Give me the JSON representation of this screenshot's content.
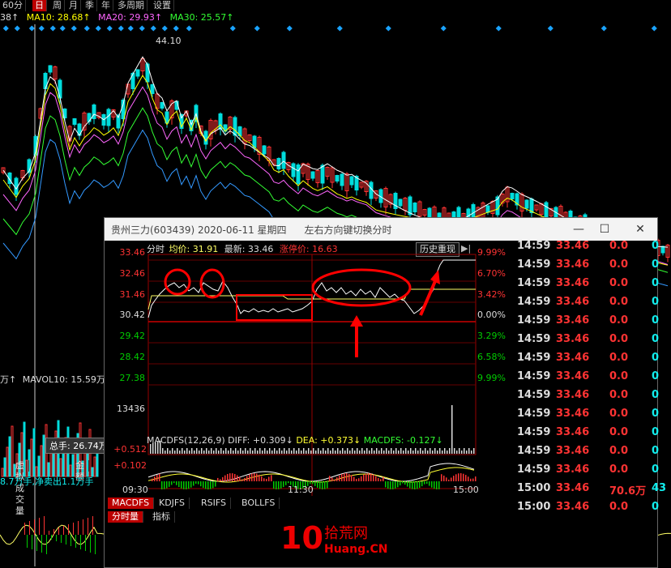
{
  "main_chart": {
    "tabs": [
      {
        "label": "60分",
        "active": false
      },
      {
        "label": "日",
        "active": true
      },
      {
        "label": "周",
        "active": false
      },
      {
        "label": "月",
        "active": false
      },
      {
        "label": "季",
        "active": false
      },
      {
        "label": "年",
        "active": false
      },
      {
        "label": "多周期",
        "active": false
      },
      {
        "label": "设置",
        "active": false
      }
    ],
    "ma_line": {
      "ma5_tail": "38↑",
      "ma10": "MA10: 28.68↑",
      "ma20": "MA20: 29.93↑",
      "ma30": "MA30: 25.57↑"
    },
    "high_label": "44.10",
    "volume_panel": {
      "mavol_left": "万↑",
      "mavol10": "MAVOL10: 15.59万↑",
      "tooltip": "总手: 26.74万"
    },
    "bottom_tabs": [
      "虚拟成交量",
      "金额"
    ],
    "bottom_info": "8.7万手,净卖出1.1万手"
  },
  "popup": {
    "title": "贵州三力(603439)  2020-06-11 星期四",
    "hint": "左右方向键切换分时",
    "info": {
      "label": "分时",
      "avg": "均价: 31.91",
      "latest": "最新: 33.46",
      "limit": "涨停价: 16.63"
    },
    "history_button": "历史重现",
    "left_ticks": [
      "33.46",
      "32.46",
      "31.46",
      "30.42",
      "29.42",
      "28.42",
      "27.38"
    ],
    "right_ticks": [
      "9.99%",
      "6.70%",
      "3.42%",
      "0.00%",
      "3.29%",
      "6.58%",
      "9.99%"
    ],
    "volume_tick": "13436",
    "macd_line": {
      "title": "MACDFS(12,26,9)",
      "diff": "DIFF: +0.309↓",
      "dea": "DEA: +0.373↓",
      "macdfs": "MACDFS: -0.127↓"
    },
    "macd_ticks": [
      "+0.512",
      "+0.102"
    ],
    "time_labels": [
      "09:30",
      "11:30",
      "15:00"
    ],
    "indicator_tabs": [
      {
        "label": "MACDFS",
        "active": true
      },
      {
        "label": "KDJFS",
        "active": false
      },
      {
        "label": "RSIFS",
        "active": false
      },
      {
        "label": "BOLLFS",
        "active": false
      }
    ],
    "sub_tabs": [
      {
        "label": "分时量",
        "active": true
      },
      {
        "label": "指标",
        "active": false
      }
    ],
    "colors": {
      "up": "#ff3333",
      "down": "#00cc00",
      "axis": "#b00000",
      "price_line": "#ffffff",
      "avg_line": "#ffff66"
    }
  },
  "tick_table": [
    {
      "time": "14:59",
      "price": "33.46",
      "vol": "0.0",
      "cnt": "0"
    },
    {
      "time": "14:59",
      "price": "33.46",
      "vol": "0.0",
      "cnt": "0"
    },
    {
      "time": "14:59",
      "price": "33.46",
      "vol": "0.0",
      "cnt": "0"
    },
    {
      "time": "14:59",
      "price": "33.46",
      "vol": "0.0",
      "cnt": "0"
    },
    {
      "time": "14:59",
      "price": "33.46",
      "vol": "0.0",
      "cnt": "0"
    },
    {
      "time": "14:59",
      "price": "33.46",
      "vol": "0.0",
      "cnt": "0"
    },
    {
      "time": "14:59",
      "price": "33.46",
      "vol": "0.0",
      "cnt": "0"
    },
    {
      "time": "14:59",
      "price": "33.46",
      "vol": "0.0",
      "cnt": "0"
    },
    {
      "time": "14:59",
      "price": "33.46",
      "vol": "0.0",
      "cnt": "0"
    },
    {
      "time": "14:59",
      "price": "33.46",
      "vol": "0.0",
      "cnt": "0"
    },
    {
      "time": "14:59",
      "price": "33.46",
      "vol": "0.0",
      "cnt": "0"
    },
    {
      "time": "14:59",
      "price": "33.46",
      "vol": "0.0",
      "cnt": "0"
    },
    {
      "time": "14:59",
      "price": "33.46",
      "vol": "0.0",
      "cnt": "0"
    },
    {
      "time": "15:00",
      "price": "33.46",
      "vol": "70.6万",
      "cnt": "43"
    },
    {
      "time": "15:00",
      "price": "33.46",
      "vol": "0.0",
      "cnt": "0"
    }
  ],
  "watermark": {
    "big": "10",
    "cn": "拾荒网",
    "en": "Huang.CN"
  }
}
